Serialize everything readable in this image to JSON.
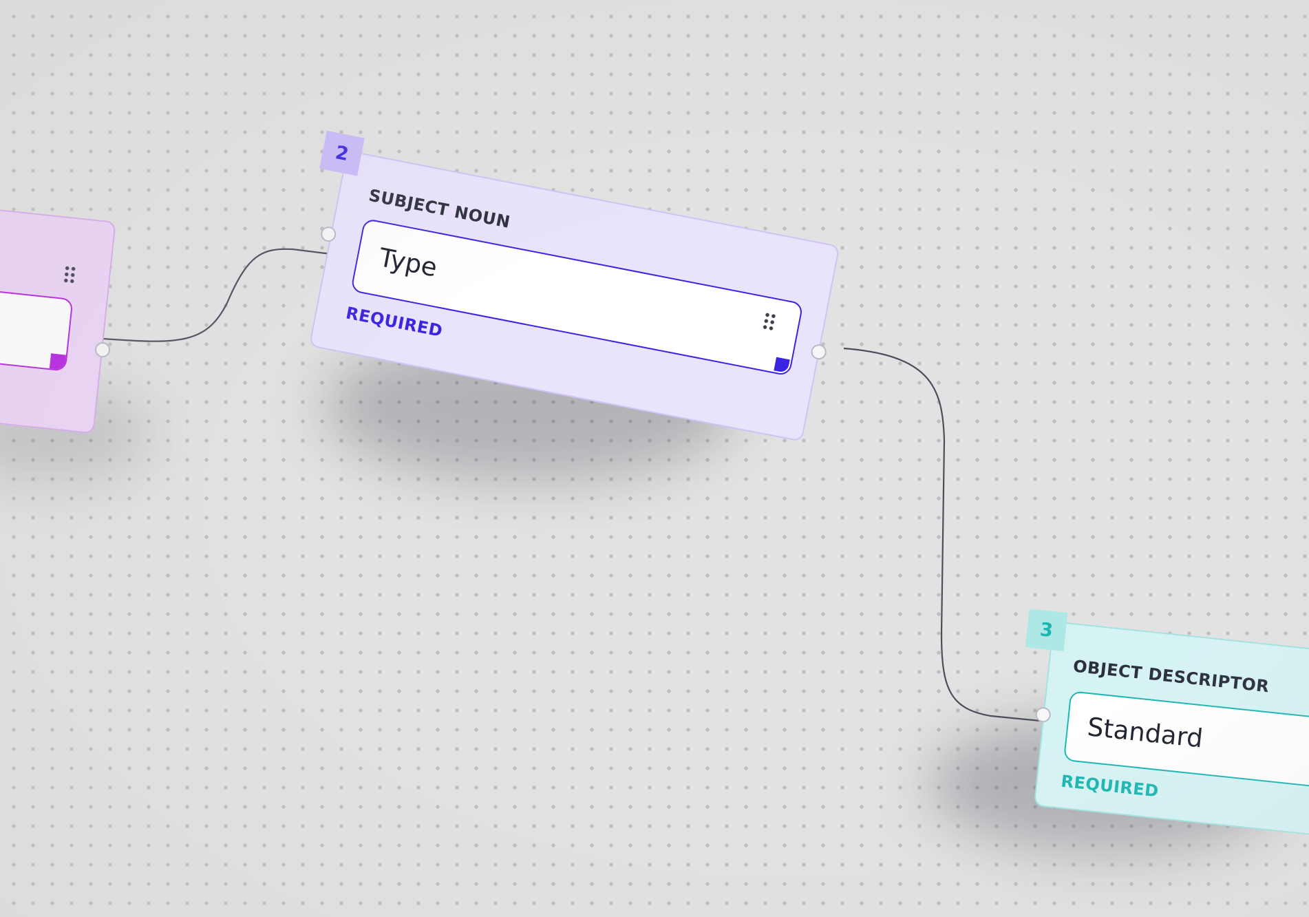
{
  "canvas": {
    "background": "#e2e2e2",
    "dot_color": "#a0a0a0"
  },
  "nodes": [
    {
      "id": "node-1",
      "number": "",
      "title": "",
      "value": "",
      "required_label": "",
      "accent": "#b41fe0",
      "card_color": "#ecd4f7"
    },
    {
      "id": "node-2",
      "number": "2",
      "title": "SUBJECT NOUN",
      "value": "Type",
      "required_label": "REQUIRED",
      "accent": "#3b24e0",
      "card_color": "#e9e3fc",
      "badge_color": "#c9baf9"
    },
    {
      "id": "node-3",
      "number": "3",
      "title": "OBJECT DESCRIPTOR",
      "value": "Standard",
      "required_label": "REQUIRED",
      "accent": "#1cb6b2",
      "card_color": "#d6f3f4",
      "badge_color": "#aee8e6"
    }
  ],
  "icons": {
    "drag_handle": "drag-handle-icon",
    "port": "connector-port-icon"
  },
  "wires": {
    "color": "#4a4d5c"
  }
}
